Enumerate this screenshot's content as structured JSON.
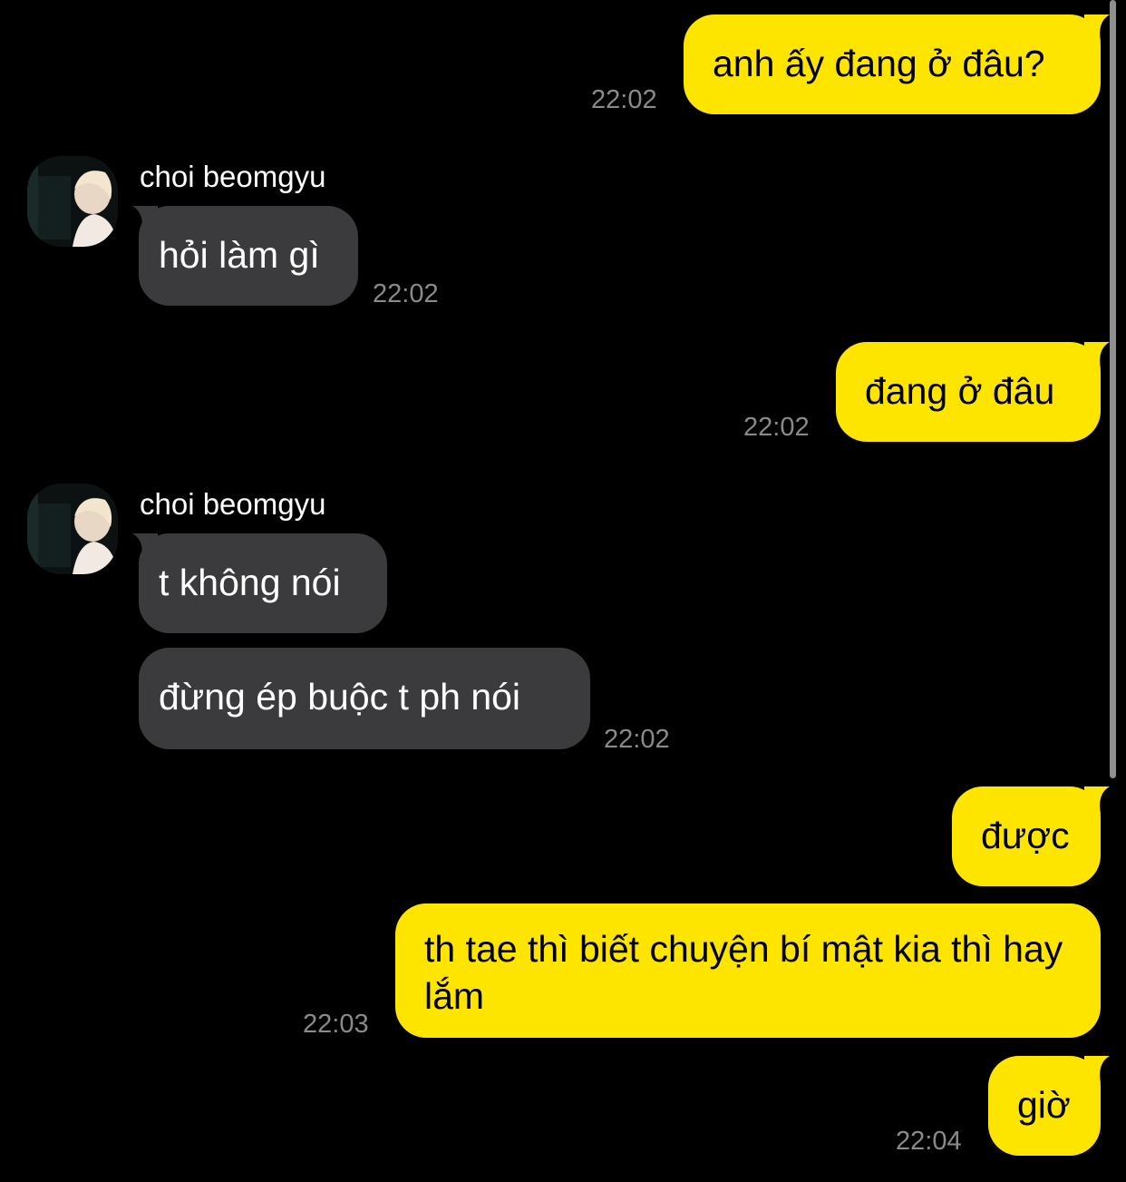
{
  "chat": {
    "messages": [
      {
        "sender": "me",
        "text": "anh ấy đang ở đâu?",
        "time": "22:02"
      },
      {
        "sender": "them",
        "name": "choi beomgyu",
        "text": "hỏi làm gì",
        "time": "22:02",
        "avatar_icon": "profile-photo-icon"
      },
      {
        "sender": "me",
        "text": "đang ở đâu",
        "time": "22:02"
      },
      {
        "sender": "them",
        "name": "choi beomgyu",
        "text": "t không nói",
        "avatar_icon": "profile-photo-icon"
      },
      {
        "sender": "them",
        "text": "đừng ép buộc t ph nói",
        "time": "22:02"
      },
      {
        "sender": "me",
        "text": "được"
      },
      {
        "sender": "me",
        "text": "th tae thì biết chuyện bí mật kia thì hay lắm",
        "time": "22:03"
      },
      {
        "sender": "me",
        "text": "giờ",
        "time": "22:04"
      }
    ]
  },
  "colors": {
    "background": "#000000",
    "my_bubble": "#fee500",
    "their_bubble": "#3b3b3d",
    "timestamp": "#8a8a8a"
  }
}
